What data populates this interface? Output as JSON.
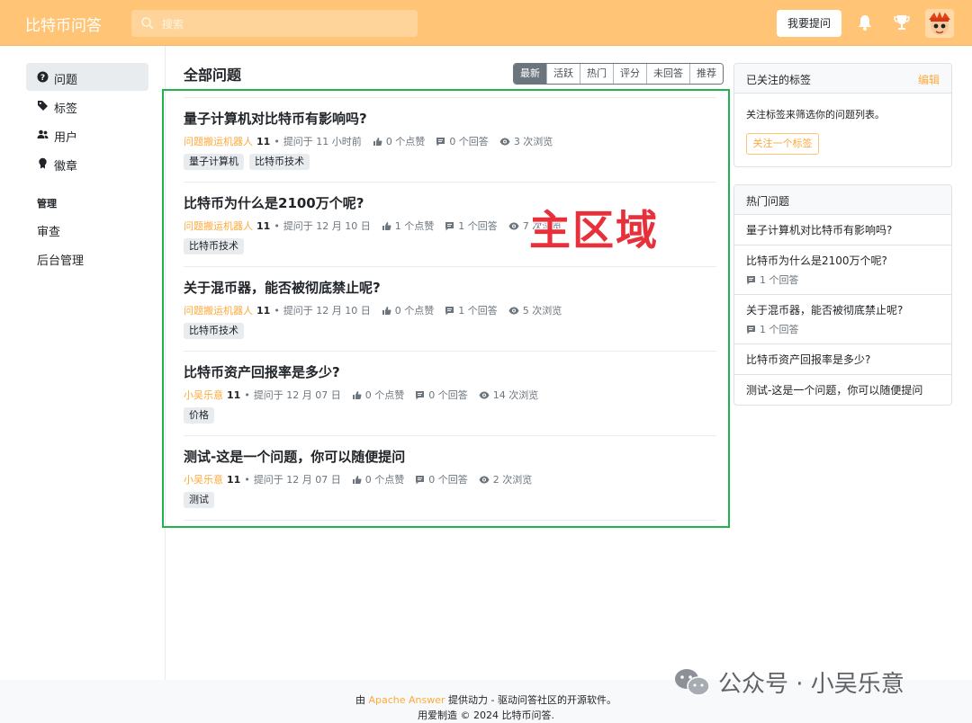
{
  "header": {
    "brand": "比特币问答",
    "search_placeholder": "搜索",
    "ask_button": "我要提问",
    "icons": [
      "search-icon",
      "bell-icon",
      "trophy-icon",
      "avatar"
    ],
    "accent_color": "#ffc475"
  },
  "sidebar": {
    "items": [
      {
        "label": "问题",
        "icon": "question-circle-icon",
        "active": true
      },
      {
        "label": "标签",
        "icon": "tag-icon",
        "active": false
      },
      {
        "label": "用户",
        "icon": "users-icon",
        "active": false
      },
      {
        "label": "徽章",
        "icon": "badge-icon",
        "active": false
      }
    ],
    "section_title": "管理",
    "admin_items": [
      {
        "label": "审查"
      },
      {
        "label": "后台管理"
      }
    ]
  },
  "main": {
    "title": "全部问题",
    "sort_tabs": [
      "最新",
      "活跃",
      "热门",
      "评分",
      "未回答",
      "推荐"
    ],
    "active_sort": "最新",
    "overlay_label": "主区域",
    "questions": [
      {
        "title": "量子计算机对比特币有影响吗?",
        "author": "问题搬运机器人",
        "rep": "11",
        "time": "提问于 11 小时前",
        "votes": "0 个点赞",
        "answers": "0 个回答",
        "views": "3 次浏览",
        "tags": [
          "量子计算机",
          "比特币技术"
        ]
      },
      {
        "title": "比特币为什么是2100万个呢?",
        "author": "问题搬运机器人",
        "rep": "11",
        "time": "提问于 12 月 10 日",
        "votes": "1 个点赞",
        "answers": "1 个回答",
        "views": "7 次浏览",
        "tags": [
          "比特币技术"
        ]
      },
      {
        "title": "关于混币器，能否被彻底禁止呢?",
        "author": "问题搬运机器人",
        "rep": "11",
        "time": "提问于 12 月 10 日",
        "votes": "0 个点赞",
        "answers": "1 个回答",
        "views": "5 次浏览",
        "tags": [
          "比特币技术"
        ]
      },
      {
        "title": "比特币资产回报率是多少?",
        "author": "小吴乐意",
        "rep": "11",
        "time": "提问于 12 月 07 日",
        "votes": "0 个点赞",
        "answers": "0 个回答",
        "views": "14 次浏览",
        "tags": [
          "价格"
        ]
      },
      {
        "title": "测试-这是一个问题，你可以随便提问",
        "author": "小吴乐意",
        "rep": "11",
        "time": "提问于 12 月 07 日",
        "votes": "0 个点赞",
        "answers": "0 个回答",
        "views": "2 次浏览",
        "tags": [
          "测试"
        ]
      }
    ]
  },
  "followed_tags": {
    "title": "已关注的标签",
    "edit": "编辑",
    "description": "关注标签来筛选你的问题列表。",
    "button": "关注一个标签"
  },
  "hot_questions": {
    "title": "热门问题",
    "items": [
      {
        "title": "量子计算机对比特币有影响吗?",
        "count": ""
      },
      {
        "title": "比特币为什么是2100万个呢?",
        "count": "1 个回答"
      },
      {
        "title": "关于混币器，能否被彻底禁止呢?",
        "count": "1 个回答"
      },
      {
        "title": "比特币资产回报率是多少?",
        "count": ""
      },
      {
        "title": "测试-这是一个问题，你可以随便提问",
        "count": ""
      }
    ]
  },
  "footer": {
    "prefix": "由 ",
    "link": "Apache Answer",
    "suffix": " 提供动力 - 驱动问答社区的开源软件。",
    "line2": "用爱制造 © 2024 比特币问答.",
    "watermark": "公众号 · 小吴乐意"
  }
}
